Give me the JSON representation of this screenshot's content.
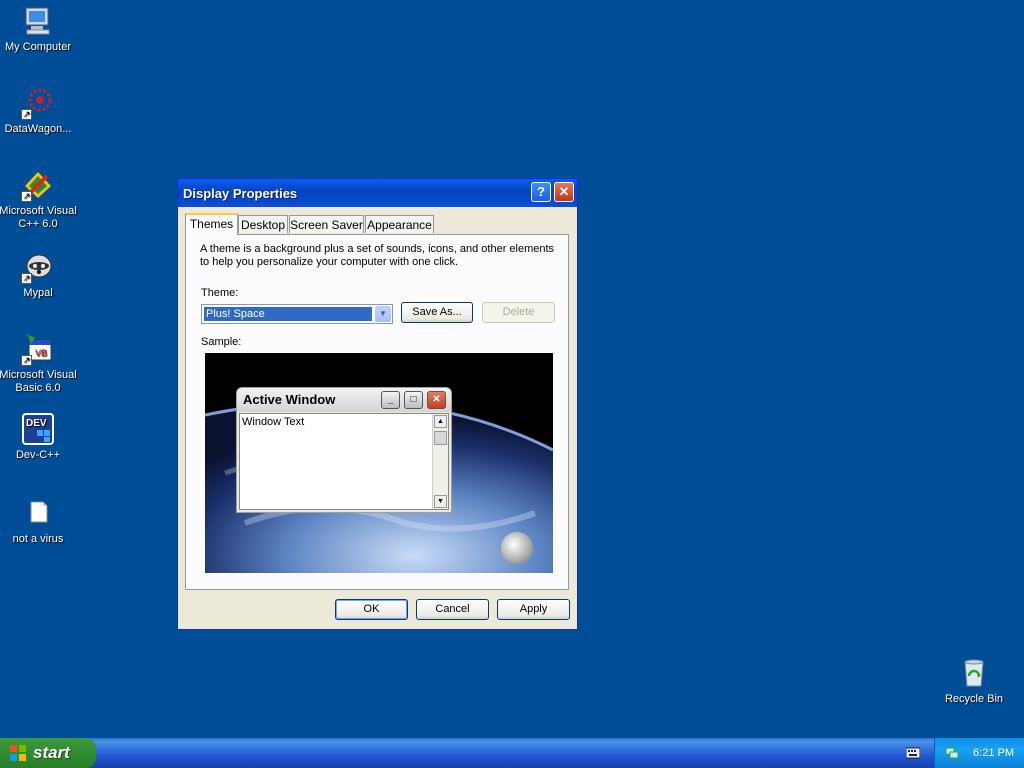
{
  "desktop": {
    "icons": [
      {
        "label": "My Computer",
        "icon": "computer-icon"
      },
      {
        "label": "DataWagon...",
        "icon": "datawagon-icon"
      },
      {
        "label": "Microsoft Visual C++ 6.0",
        "icon": "visual-cpp-icon"
      },
      {
        "label": "Mypal",
        "icon": "mypal-icon"
      },
      {
        "label": "Microsoft Visual Basic 6.0",
        "icon": "visual-basic-icon"
      },
      {
        "label": "Dev-C++",
        "icon": "dev-cpp-icon"
      },
      {
        "label": "not a virus",
        "icon": "file-icon"
      },
      {
        "label": "Recycle Bin",
        "icon": "recycle-bin-icon"
      }
    ]
  },
  "dialog": {
    "title": "Display Properties",
    "help_glyph": "?",
    "close_glyph": "✕",
    "tabs": [
      "Themes",
      "Desktop",
      "Screen Saver",
      "Appearance"
    ],
    "active_tab": "Themes",
    "description": "A theme is a background plus a set of sounds, icons, and other elements to help you personalize your computer with one click.",
    "theme_label": "Theme:",
    "theme_value": "Plus! Space",
    "save_as": "Save As...",
    "delete": "Delete",
    "sample_label": "Sample:",
    "sample": {
      "window_title": "Active Window",
      "window_text": "Window Text"
    },
    "ok": "OK",
    "cancel": "Cancel",
    "apply": "Apply"
  },
  "taskbar": {
    "start_label": "start",
    "clock": "6:21 PM"
  },
  "colors": {
    "desktop": "#004e98",
    "titlebar": "#0542c0",
    "start_button": "#3c9a3c",
    "tray": "#19a0f3"
  }
}
